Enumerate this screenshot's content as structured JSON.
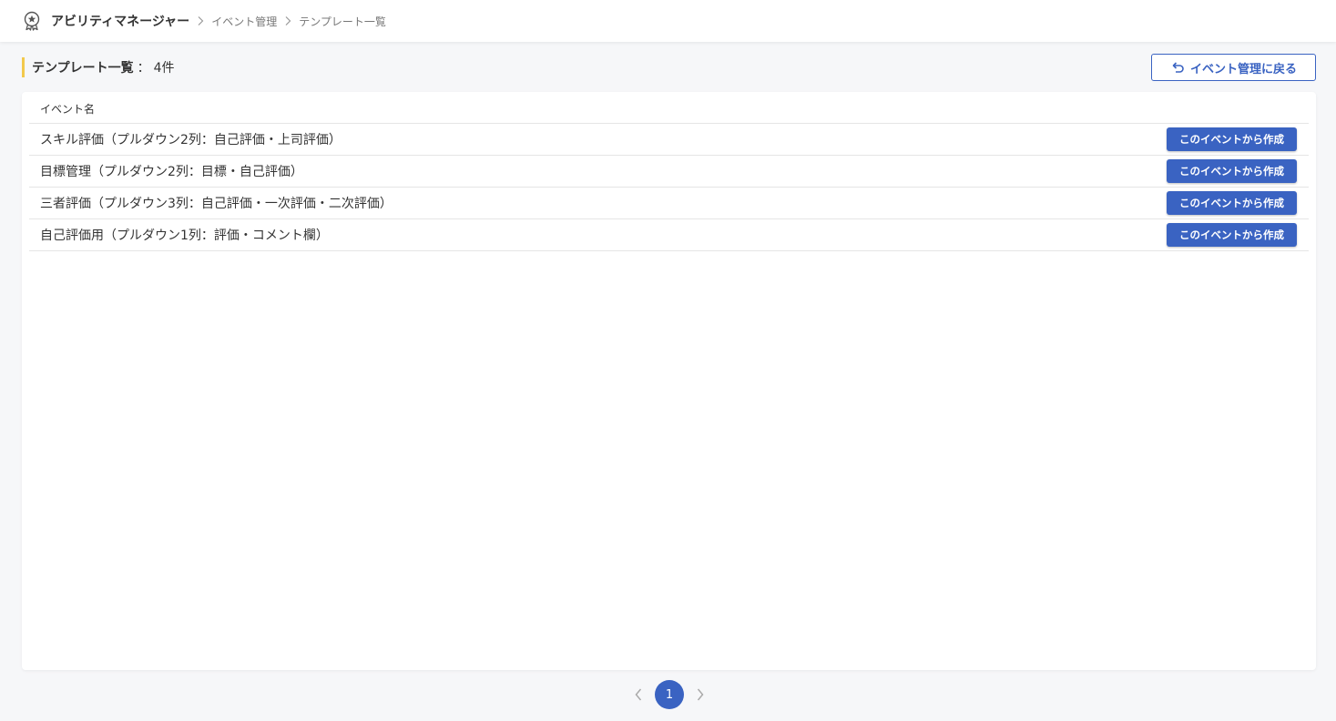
{
  "colors": {
    "accent": "#3a63c2",
    "heading_marker": "#f2c94c",
    "background": "#f6f7f9"
  },
  "topbar": {
    "icon": "award-medal-icon",
    "app_title": "アビリティマネージャー",
    "breadcrumbs": [
      "イベント管理",
      "テンプレート一覧"
    ]
  },
  "header": {
    "title": "テンプレート一覧",
    "separator": "：",
    "count_label": "4件",
    "back_button": {
      "icon": "undo-arrow-icon",
      "label": "イベント管理に戻る"
    }
  },
  "table": {
    "column_header": "イベント名",
    "rows": [
      {
        "name": "スキル評価（プルダウン2列：自己評価・上司評価）",
        "action": "このイベントから作成"
      },
      {
        "name": "目標管理（プルダウン2列：目標・自己評価）",
        "action": "このイベントから作成"
      },
      {
        "name": "三者評価（プルダウン3列：自己評価・一次評価・二次評価）",
        "action": "このイベントから作成"
      },
      {
        "name": "自己評価用（プルダウン1列：評価・コメント欄）",
        "action": "このイベントから作成"
      }
    ]
  },
  "pagination": {
    "current_page": "1"
  }
}
